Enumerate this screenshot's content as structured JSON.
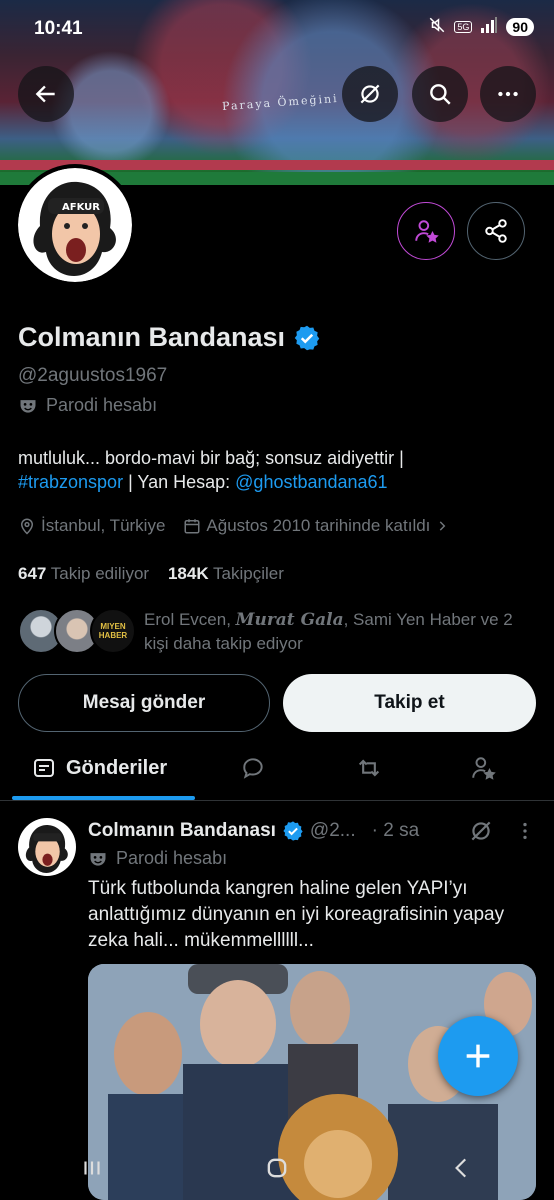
{
  "status_bar": {
    "time": "10:41",
    "network": "5G",
    "battery": "90"
  },
  "banner": {
    "tifo_text": "Paraya Ömeğini"
  },
  "profile": {
    "name": "Colmanın Bandanası",
    "handle": "@2aguustos1967",
    "parody_label": "Parodi hesabı",
    "bio_part1": "mutluluk... bordo-mavi bir bağ; sonsuz aidiyettir |",
    "bio_hashtag": "#trabzonspor",
    "bio_part2": " | Yan Hesap: ",
    "bio_mention": "@ghostbandana61",
    "location": "İstanbul, Türkiye",
    "joined": "Ağustos 2010 tarihinde katıldı",
    "following_count": "647",
    "following_label": "Takip ediliyor",
    "followers_count": "184K",
    "followers_label": "Takipçiler",
    "followed_by_1": "Erol Evcen, ",
    "followed_by_2": "Murat Gala",
    "followed_by_3": ", Sami Yen Haber ve 2 kişi daha takip ediyor",
    "avatar_text": "AFKUR",
    "mini_avatar_text": "MIYEN HABER"
  },
  "buttons": {
    "message": "Mesaj gönder",
    "follow": "Takip et"
  },
  "tabs": {
    "posts": "Gönderiler"
  },
  "post": {
    "name": "Colmanın Bandanası",
    "handle": "@2...",
    "time": "· 2 sa",
    "parody_label": "Parodi hesabı",
    "text": "Türk futbolunda kangren haline gelen YAPI’yı anlattığımız dünyanın en iyi koreagrafisinin yapay zeka hali... mükemmellllll..."
  },
  "colors": {
    "accent": "#1d9bf0",
    "grok_purple": "#c04ad6",
    "background": "#000000"
  }
}
